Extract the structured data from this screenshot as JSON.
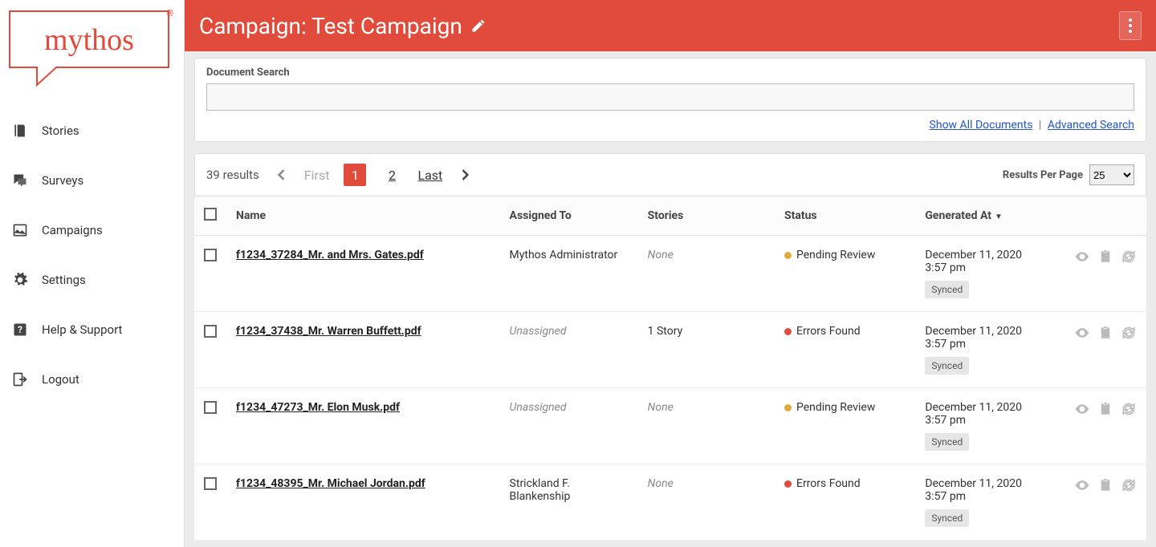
{
  "brand": {
    "name": "mythos"
  },
  "sidebar": {
    "items": [
      {
        "label": "Stories",
        "name": "stories",
        "icon": "book"
      },
      {
        "label": "Surveys",
        "name": "surveys",
        "icon": "chat"
      },
      {
        "label": "Campaigns",
        "name": "campaigns",
        "icon": "image"
      },
      {
        "label": "Settings",
        "name": "settings",
        "icon": "gear"
      },
      {
        "label": "Help & Support",
        "name": "help",
        "icon": "help"
      },
      {
        "label": "Logout",
        "name": "logout",
        "icon": "logout"
      }
    ]
  },
  "header": {
    "title": "Campaign: Test Campaign"
  },
  "search": {
    "label": "Document Search",
    "value": "",
    "show_all": "Show All Documents",
    "advanced": "Advanced Search"
  },
  "pagination": {
    "results_text": "39 results",
    "first": "First",
    "last": "Last",
    "pages": [
      "1",
      "2"
    ],
    "current": "1",
    "rpp_label": "Results Per Page",
    "rpp_value": "25"
  },
  "table": {
    "columns": {
      "name": "Name",
      "assigned": "Assigned To",
      "stories": "Stories",
      "status": "Status",
      "generated": "Generated At"
    },
    "rows": [
      {
        "name": "f1234_37284_Mr. and Mrs. Gates.pdf",
        "assigned": "Mythos Administrator",
        "stories": "None",
        "stories_muted": true,
        "status": "Pending Review",
        "status_color": "orange",
        "generated_date": "December 11, 2020",
        "generated_time": "3:57 pm",
        "sync": "Synced"
      },
      {
        "name": "f1234_37438_Mr. Warren Buffett.pdf",
        "assigned": "Unassigned",
        "assigned_muted": true,
        "stories": "1 Story",
        "stories_muted": false,
        "status": "Errors Found",
        "status_color": "red",
        "generated_date": "December 11, 2020",
        "generated_time": "3:57 pm",
        "sync": "Synced"
      },
      {
        "name": "f1234_47273_Mr. Elon Musk.pdf",
        "assigned": "Unassigned",
        "assigned_muted": true,
        "stories": "None",
        "stories_muted": true,
        "status": "Pending Review",
        "status_color": "orange",
        "generated_date": "December 11, 2020",
        "generated_time": "3:57 pm",
        "sync": "Synced"
      },
      {
        "name": "f1234_48395_Mr. Michael Jordan.pdf",
        "assigned": "Strickland F. Blankenship",
        "stories": "None",
        "stories_muted": true,
        "status": "Errors Found",
        "status_color": "red",
        "generated_date": "December 11, 2020",
        "generated_time": "3:57 pm",
        "sync": "Synced"
      }
    ]
  }
}
